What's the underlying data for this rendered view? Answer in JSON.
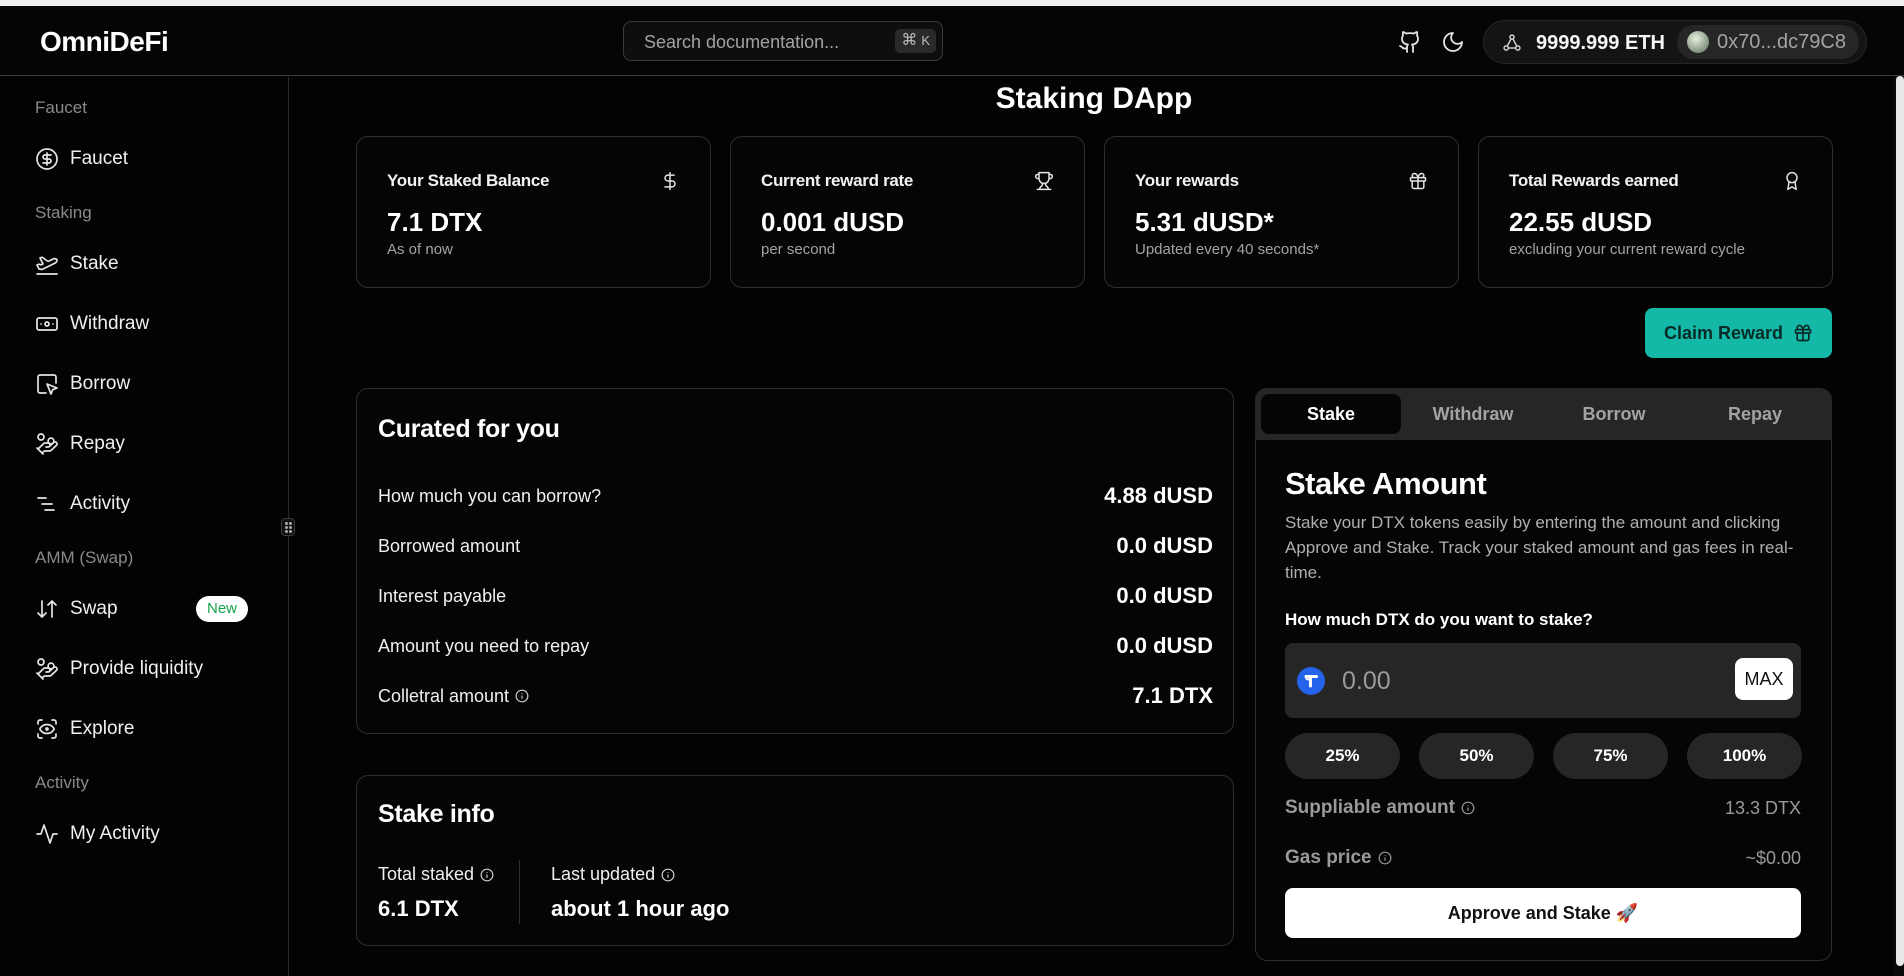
{
  "header": {
    "logo": "OmniDeFi",
    "search_placeholder": "Search documentation...",
    "search_kbd_symbol": "⌘",
    "search_kbd_key": "K",
    "eth_balance": "9999.999 ETH",
    "address": "0x70...dc79C8"
  },
  "sidebar": {
    "sections": {
      "faucet": "Faucet",
      "staking": "Staking",
      "amm": "AMM (Swap)",
      "activity": "Activity"
    },
    "items": {
      "faucet": "Faucet",
      "stake": "Stake",
      "withdraw": "Withdraw",
      "borrow": "Borrow",
      "repay": "Repay",
      "activity": "Activity",
      "swap": "Swap",
      "swap_badge": "New",
      "provide_liquidity": "Provide liquidity",
      "explore": "Explore",
      "my_activity": "My Activity"
    }
  },
  "main": {
    "title": "Staking DApp",
    "stats": [
      {
        "label": "Your Staked Balance",
        "value": "7.1 DTX",
        "sub": "As of now",
        "icon": "dollar-icon"
      },
      {
        "label": "Current reward rate",
        "value": "0.001 dUSD",
        "sub": "per second",
        "icon": "trophy-icon"
      },
      {
        "label": "Your rewards",
        "value": "5.31 dUSD*",
        "sub": "Updated every 40 seconds*",
        "icon": "gift-icon"
      },
      {
        "label": "Total Rewards earned",
        "value": "22.55 dUSD",
        "sub": "excluding your current reward cycle",
        "icon": "award-icon"
      }
    ],
    "claim_label": "Claim Reward",
    "curated": {
      "title": "Curated for you",
      "rows": [
        {
          "label": "How much you can borrow?",
          "value": "4.88 dUSD"
        },
        {
          "label": "Borrowed amount",
          "value": "0.0 dUSD"
        },
        {
          "label": "Interest payable",
          "value": "0.0 dUSD"
        },
        {
          "label": "Amount you need to repay",
          "value": "0.0 dUSD"
        },
        {
          "label": "Colletral amount",
          "value": "7.1 DTX"
        }
      ]
    },
    "stake_info": {
      "title": "Stake info",
      "total_staked_label": "Total staked",
      "total_staked_value": "6.1 DTX",
      "last_updated_label": "Last updated",
      "last_updated_value": "about 1 hour ago"
    }
  },
  "panel": {
    "tabs": [
      "Stake",
      "Withdraw",
      "Borrow",
      "Repay"
    ],
    "active_tab": "Stake",
    "title": "Stake Amount",
    "description": "Stake your DTX tokens easily by entering the amount and clicking Approve and Stake. Track your staked amount and gas fees in real-time.",
    "question": "How much DTX do you want to stake?",
    "amount_placeholder": "0.00",
    "max_label": "MAX",
    "percent_buttons": [
      "25%",
      "50%",
      "75%",
      "100%"
    ],
    "suppliable_label": "Suppliable amount",
    "suppliable_value": "13.3 DTX",
    "gas_label": "Gas price",
    "gas_value": "~$0.00",
    "approve_label": "Approve and Stake 🚀"
  },
  "colors": {
    "accent": "#14b8a6",
    "background": "#030303",
    "card_border": "#2e2e2e",
    "badge_text": "#16a34a"
  }
}
